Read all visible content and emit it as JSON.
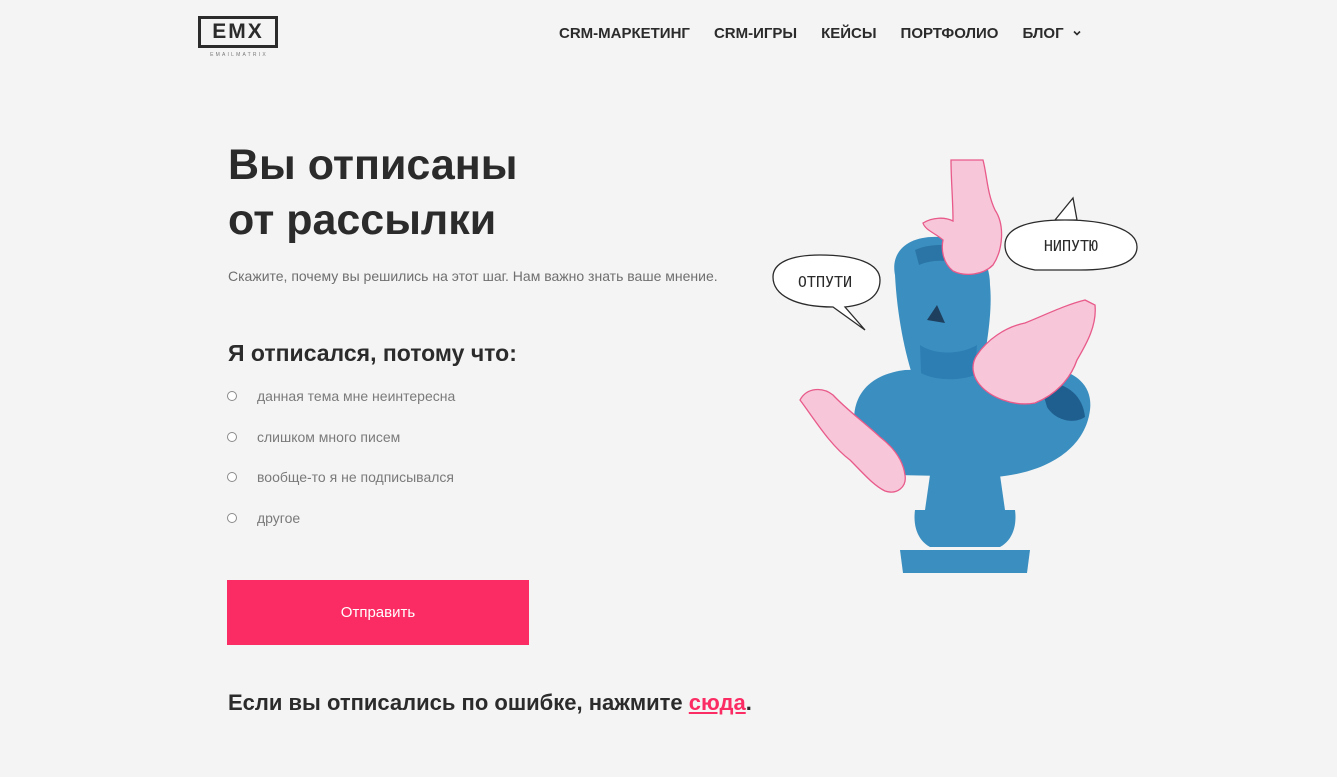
{
  "logo": {
    "text": "EMX",
    "subtext": "EMAILMATRIX"
  },
  "nav": {
    "items": [
      {
        "label": "CRM-МАРКЕТИНГ"
      },
      {
        "label": "CRM-ИГРЫ"
      },
      {
        "label": "КЕЙСЫ"
      },
      {
        "label": "ПОРТФОЛИО"
      },
      {
        "label": "БЛОГ"
      }
    ]
  },
  "main": {
    "title_line1": "Вы отписаны",
    "title_line2": "от рассылки",
    "subtitle": "Скажите, почему вы решились на этот шаг. Нам важно знать ваше мнение.",
    "reason_heading": "Я отписался, потому что:",
    "options": [
      {
        "label": "данная тема мне неинтересна"
      },
      {
        "label": "слишком много писем"
      },
      {
        "label": "вообще-то я не подписывался"
      },
      {
        "label": "другое"
      }
    ],
    "submit_label": "Отправить",
    "footer_prefix": "Если вы отписались по ошибке, нажмите ",
    "footer_link": "сюда",
    "footer_suffix": "."
  },
  "illustration": {
    "bubble_left": "ОТПУТИ",
    "bubble_right": "НИПУТЮ"
  },
  "colors": {
    "accent": "#fb2c63",
    "statue": "#3b8fc0",
    "statue_dark": "#1f5f8f",
    "hands": "#f7c6d8",
    "background": "#f4f4f4",
    "text": "#2b2b2b"
  }
}
